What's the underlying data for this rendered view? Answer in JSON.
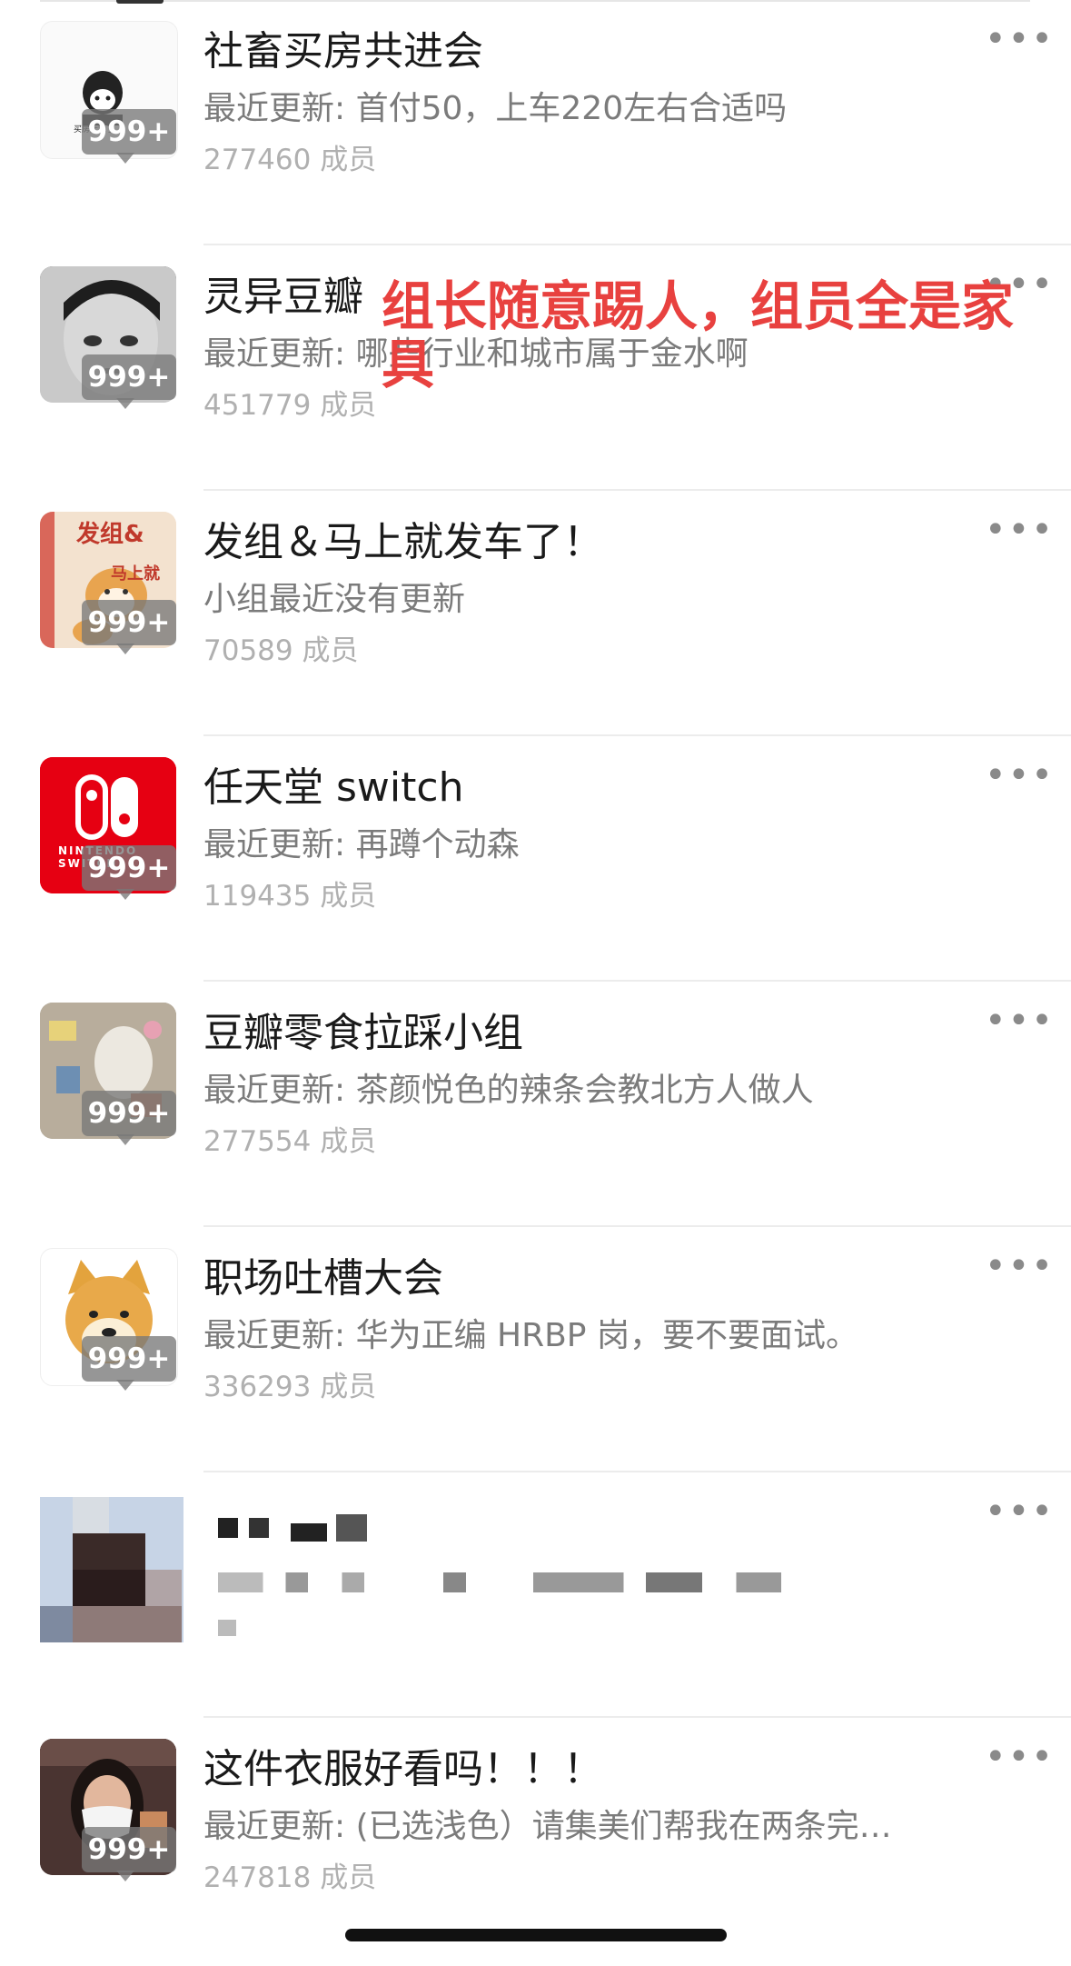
{
  "groups": [
    {
      "title": "社畜买房共进会",
      "subtitle": "最近更新: 首付50，上车220左右合适吗",
      "members": "277460 成员",
      "badge": "999+",
      "avatar": "cartoon-avatar",
      "avatar_text": "买房太难了"
    },
    {
      "title": "灵异豆瓣",
      "subtitle": "最近更新: 哪些行业和城市属于金水啊",
      "members": "451779 成员",
      "badge": "999+",
      "avatar": "bw-child-photo"
    },
    {
      "title": "发组＆马上就发车了！",
      "subtitle": "小组最近没有更新",
      "members": "70589 成员",
      "badge": "999+",
      "avatar": "shiba-illustration",
      "avatar_text": [
        "发组&",
        "马上就"
      ]
    },
    {
      "title": "任天堂 switch",
      "subtitle": "最近更新: 再蹲个动森",
      "members": "119435 成员",
      "badge": "999+",
      "avatar": "nintendo-switch-logo",
      "avatar_text": "NINTENDO SWITCH"
    },
    {
      "title": "豆瓣零食拉踩小组",
      "subtitle": "最近更新: 茶颜悦色的辣条会教北方人做人",
      "members": "277554 成员",
      "badge": "999+",
      "avatar": "snacks-photo"
    },
    {
      "title": "职场吐槽大会",
      "subtitle": "最近更新: 华为正编 HRBP 岗，要不要面试。",
      "members": "336293 成员",
      "badge": "999+",
      "avatar": "doge-avatar"
    },
    {
      "title": "",
      "subtitle": "",
      "members": "",
      "badge": "",
      "avatar": "pixelated"
    },
    {
      "title": "这件衣服好看吗！！！",
      "subtitle": "最近更新: (已选浅色）请集美们帮我在两条完…",
      "members": "247818 成员",
      "badge": "999+",
      "avatar": "masked-woman-photo"
    }
  ],
  "annotation": "组长随意踢人，组员全是家具",
  "more_label": "•••",
  "colors": {
    "annotation": "#e8413f",
    "badge_bg": "#787878",
    "switch_red": "#e60012"
  }
}
